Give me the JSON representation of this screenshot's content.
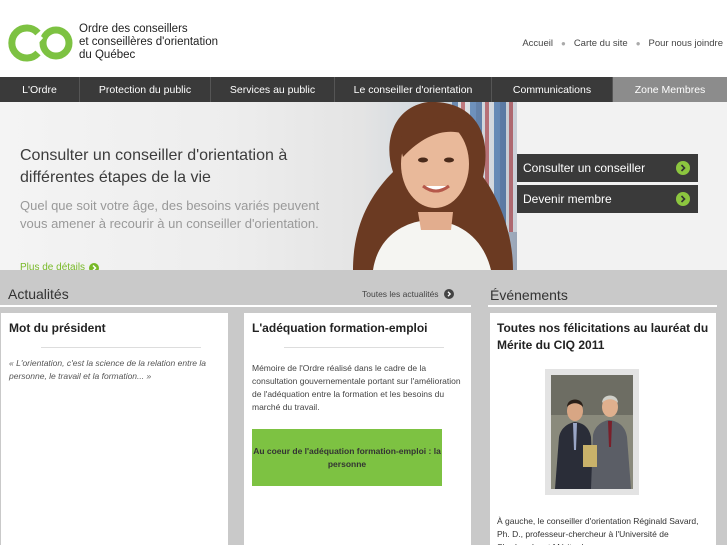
{
  "header": {
    "org_name": "Ordre des conseillers\net conseillères d'orientation\ndu Québec",
    "util_links": [
      "Accueil",
      "Carte du site",
      "Pour nous joindre"
    ],
    "brand_green": "#7dc242"
  },
  "nav": {
    "items": [
      "L'Ordre",
      "Protection du public",
      "Services au public",
      "Le conseiller d'orientation",
      "Communications",
      "Zone Membres"
    ]
  },
  "hero": {
    "title": "Consulter un conseiller d'orientation à différentes étapes de la vie",
    "text": "Quel que soit votre âge, des besoins variés peuvent vous amener à recourir à un conseiller d'orientation.",
    "more": "Plus de détails",
    "cta": [
      "Consulter un conseiller",
      "Devenir membre"
    ]
  },
  "news": {
    "title": "Actualités",
    "all_link": "Toutes les actualités",
    "card1": {
      "title": "Mot du président",
      "quote": "« L'orientation, c'est la science de la relation entre la personne, le travail et la formation... »"
    },
    "card2": {
      "title": "L'adéquation formation-emploi",
      "text": "Mémoire de l'Ordre réalisé dans le cadre de la consultation gouvernementale portant sur l'amélioration de l'adéquation entre la formation et les besoins du marché du travail.",
      "button": "Au coeur de l'adéquation formation-emploi : la personne"
    }
  },
  "events": {
    "title": "Événements",
    "card": {
      "title": "Toutes nos félicitations au lauréat du Mérite du CIQ 2011",
      "caption": "À gauche, le conseiller d'orientation Réginald Savard, Ph. D., professeur-chercheur à l'Université de Sherbrooke et Mérite du"
    }
  }
}
